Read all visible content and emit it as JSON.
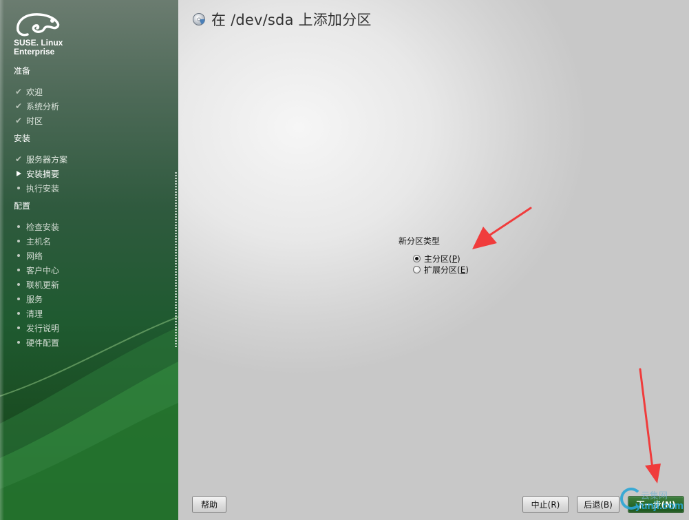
{
  "brand": {
    "line1": "SUSE. Linux",
    "line2": "Enterprise"
  },
  "sidebar": {
    "sections": [
      {
        "title": "准备"
      },
      {
        "title": "安装"
      },
      {
        "title": "配置"
      }
    ],
    "steps": [
      {
        "label": "欢迎",
        "state": "done",
        "icon": "check-icon"
      },
      {
        "label": "系统分析",
        "state": "done",
        "icon": "check-icon"
      },
      {
        "label": "时区",
        "state": "done",
        "icon": "check-icon"
      },
      {
        "label": "服务器方案",
        "state": "done",
        "icon": "check-icon"
      },
      {
        "label": "安装摘要",
        "state": "current",
        "icon": "arrow-right-icon"
      },
      {
        "label": "执行安装",
        "state": "todo",
        "icon": "bullet-icon"
      },
      {
        "label": "检查安装",
        "state": "todo",
        "icon": "bullet-icon"
      },
      {
        "label": "主机名",
        "state": "todo",
        "icon": "bullet-icon"
      },
      {
        "label": "网络",
        "state": "todo",
        "icon": "bullet-icon"
      },
      {
        "label": "客户中心",
        "state": "todo",
        "icon": "bullet-icon"
      },
      {
        "label": "联机更新",
        "state": "todo",
        "icon": "bullet-icon"
      },
      {
        "label": "服务",
        "state": "todo",
        "icon": "bullet-icon"
      },
      {
        "label": "清理",
        "state": "todo",
        "icon": "bullet-icon"
      },
      {
        "label": "发行说明",
        "state": "todo",
        "icon": "bullet-icon"
      },
      {
        "label": "硬件配置",
        "state": "todo",
        "icon": "bullet-icon"
      }
    ]
  },
  "main": {
    "title": "在 /dev/sda 上添加分区",
    "partition_type": {
      "label": "新分区类型",
      "options": [
        {
          "label_prefix": "主分区(",
          "accel": "P",
          "label_suffix": ")",
          "selected": true
        },
        {
          "label_prefix": "扩展分区(",
          "accel": "E",
          "label_suffix": ")",
          "selected": false
        }
      ]
    }
  },
  "buttons": {
    "help": "帮助",
    "abort": "中止(R)",
    "back": "后退(B)",
    "next": "下一步(N)"
  },
  "watermark": {
    "text": "yunji.com",
    "top": "云集网"
  },
  "colors": {
    "sidebar_green": "#1f5a30",
    "next_button": "#2a6a2a",
    "annotation_arrow": "#f03c3c"
  }
}
